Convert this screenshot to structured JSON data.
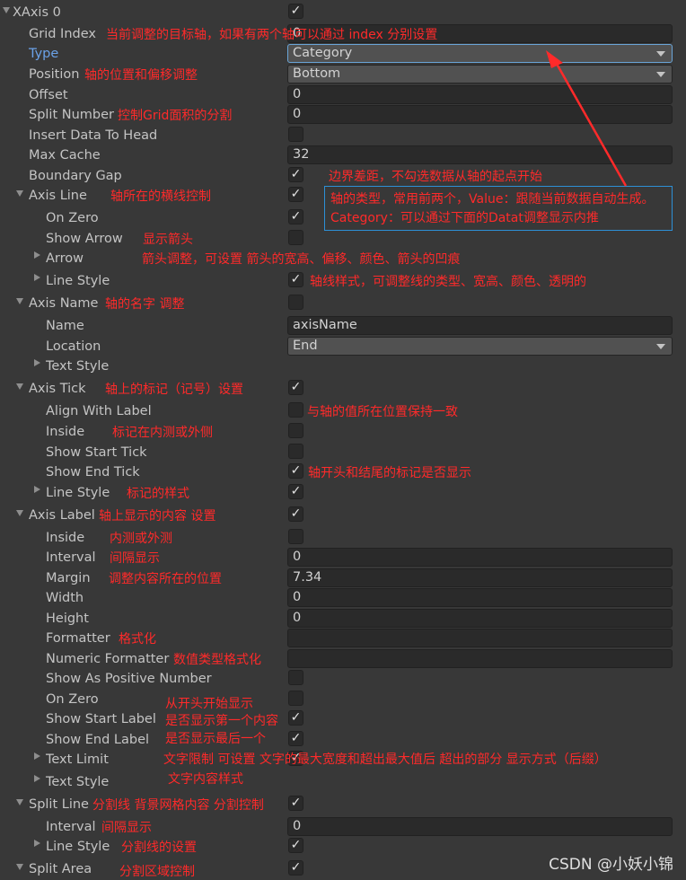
{
  "xaxis": {
    "title": "XAxis 0",
    "checked": "✓"
  },
  "grid_index": {
    "label": "Grid Index",
    "value": "0",
    "annotation": "当前调整的目标轴，如果有两个轴可以通过 index 分别设置"
  },
  "type": {
    "label": "Type",
    "value": "Category"
  },
  "position": {
    "label": "Position",
    "value": "Bottom",
    "annotation": "轴的位置和偏移调整"
  },
  "offset": {
    "label": "Offset",
    "value": "0"
  },
  "split_number": {
    "label": "Split Number",
    "value": "0",
    "annotation": "控制Grid面积的分割"
  },
  "insert_data_to_head": {
    "label": "Insert Data To Head",
    "checked": ""
  },
  "max_cache": {
    "label": "Max Cache",
    "value": "32"
  },
  "boundary_gap": {
    "label": "Boundary Gap",
    "checked": "✓",
    "annotation": "边界差距，不勾选数据从轴的起点开始"
  },
  "axis_line": {
    "label": "Axis Line",
    "checked": "✓",
    "annotation": "轴所在的横线控制",
    "on_zero": {
      "label": "On Zero",
      "checked": "✓"
    },
    "show_arrow": {
      "label": "Show Arrow",
      "checked": "",
      "annotation": "显示箭头"
    },
    "arrow": {
      "label": "Arrow",
      "annotation": "箭头调整，可设置 箭头的宽高、偏移、颜色、箭头的凹痕"
    },
    "line_style": {
      "label": "Line Style",
      "checked": "✓",
      "annotation": "轴线样式，可调整线的类型、宽高、颜色、透明的"
    }
  },
  "type_callout": {
    "line1": "轴的类型，常用前两个，Value：跟随当前数据自动生成。",
    "line2": "Category：可以通过下面的Datat调整显示内推"
  },
  "axis_name": {
    "label": "Axis Name",
    "checked": "",
    "annotation": "轴的名字 调整",
    "name": {
      "label": "Name",
      "value": "axisName"
    },
    "location": {
      "label": "Location",
      "value": "End"
    },
    "text_style": {
      "label": "Text Style"
    }
  },
  "axis_tick": {
    "label": "Axis Tick",
    "checked": "✓",
    "annotation": "轴上的标记（记号）设置",
    "align_with_label": {
      "label": "Align With Label",
      "checked": "",
      "annotation": "与轴的值所在位置保持一致"
    },
    "inside": {
      "label": "Inside",
      "checked": "",
      "annotation": "标记在内测或外侧"
    },
    "show_start_tick": {
      "label": "Show Start Tick",
      "checked": ""
    },
    "show_end_tick": {
      "label": "Show End Tick",
      "checked": "✓",
      "annotation": "轴开头和结尾的标记是否显示"
    },
    "line_style": {
      "label": "Line Style",
      "checked": "✓",
      "annotation": "标记的样式"
    }
  },
  "axis_label": {
    "label": "Axis Label",
    "checked": "✓",
    "annotation": "轴上显示的内容 设置",
    "inside": {
      "label": "Inside",
      "checked": "",
      "annotation": "内测或外测"
    },
    "interval": {
      "label": "Interval",
      "value": "0",
      "annotation": "间隔显示"
    },
    "margin": {
      "label": "Margin",
      "value": "7.34",
      "annotation": "调整内容所在的位置"
    },
    "width": {
      "label": "Width",
      "value": "0"
    },
    "height": {
      "label": "Height",
      "value": "0"
    },
    "formatter": {
      "label": "Formatter",
      "value": "",
      "annotation": "格式化"
    },
    "numeric_formatter": {
      "label": "Numeric Formatter",
      "value": "",
      "annotation": "数值类型格式化"
    },
    "show_as_positive_number": {
      "label": "Show As Positive Number",
      "checked": ""
    },
    "on_zero": {
      "label": "On Zero",
      "checked": "",
      "annotation": "从开头开始显示"
    },
    "show_start_label": {
      "label": "Show Start Label",
      "checked": "✓",
      "annotation": "是否显示第一个内容"
    },
    "show_end_label": {
      "label": "Show End Label",
      "checked": "✓",
      "annotation": "是否显示最后一个"
    },
    "text_limit": {
      "label": "Text Limit",
      "checked": "✓",
      "annotation": "文字限制 可设置 文字的最大宽度和超出最大值后 超出的部分 显示方式（后缀）"
    },
    "text_style": {
      "label": "Text Style",
      "annotation": "文字内容样式"
    }
  },
  "split_line": {
    "label": "Split Line",
    "checked": "✓",
    "annotation": "分割线 背景网格内容 分割控制",
    "interval": {
      "label": "Interval",
      "value": "0",
      "annotation": "间隔显示"
    },
    "line_style": {
      "label": "Line Style",
      "checked": "✓",
      "annotation": "分割线的设置"
    }
  },
  "split_area": {
    "label": "Split Area",
    "checked": "✓",
    "annotation": "分割区域控制"
  },
  "watermark": "CSDN @小妖小锦",
  "colors": {
    "background": "#383838",
    "field": "#2a2a2a",
    "dropdown": "#515151",
    "annotation": "#ff2a2a",
    "callout_border": "#2d8fd5",
    "highlight_label": "#6ba2e8"
  }
}
